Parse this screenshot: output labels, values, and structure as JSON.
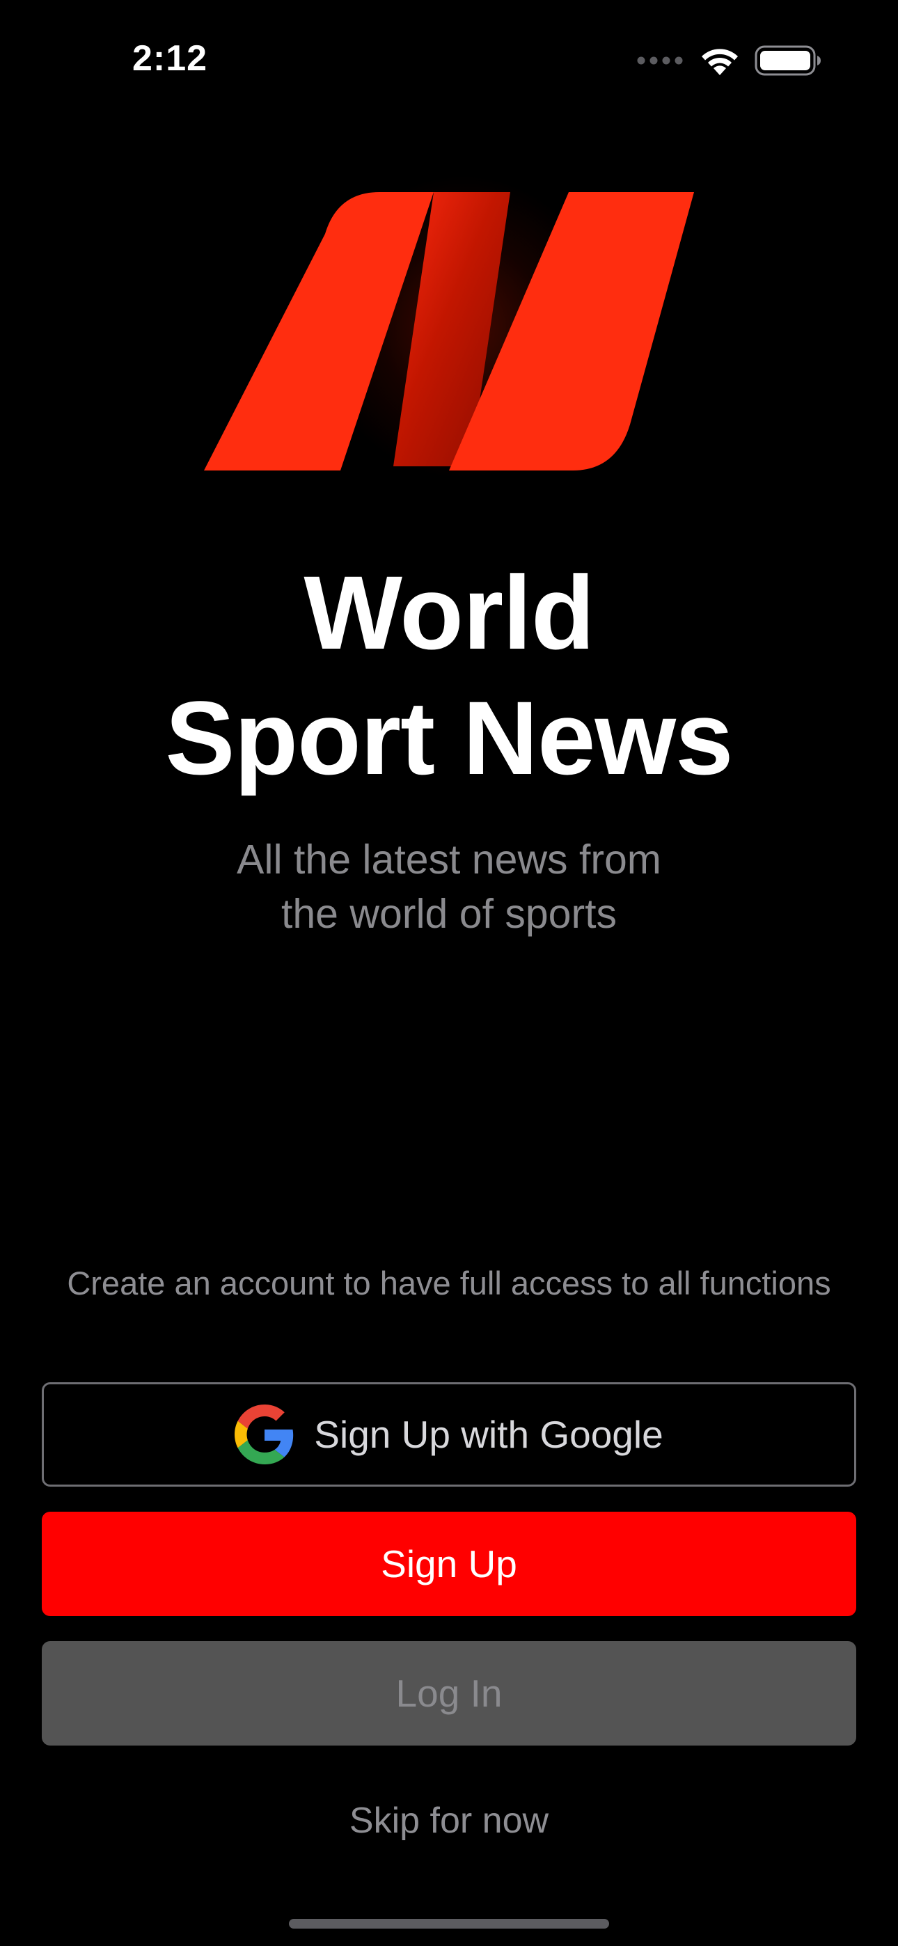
{
  "status_bar": {
    "time": "2:12",
    "icons": [
      "cellular-dots-icon",
      "wifi-icon",
      "battery-icon"
    ]
  },
  "logo": {
    "icon": "n-letter-logo",
    "colors": {
      "primary": "#ff2d0f",
      "shadow": "#b81400"
    }
  },
  "title": {
    "line1": "World",
    "line2": "Sport News"
  },
  "tagline": {
    "line1": "All the latest news from",
    "line2": "the world of sports"
  },
  "account_note": "Create an account to have full access to all functions",
  "buttons": {
    "google": {
      "label": "Sign Up with Google",
      "icon": "google-icon"
    },
    "signup": {
      "label": "Sign Up",
      "color": "#ff0000"
    },
    "login": {
      "label": "Log In",
      "color": "#545454"
    }
  },
  "skip": "Skip for now"
}
